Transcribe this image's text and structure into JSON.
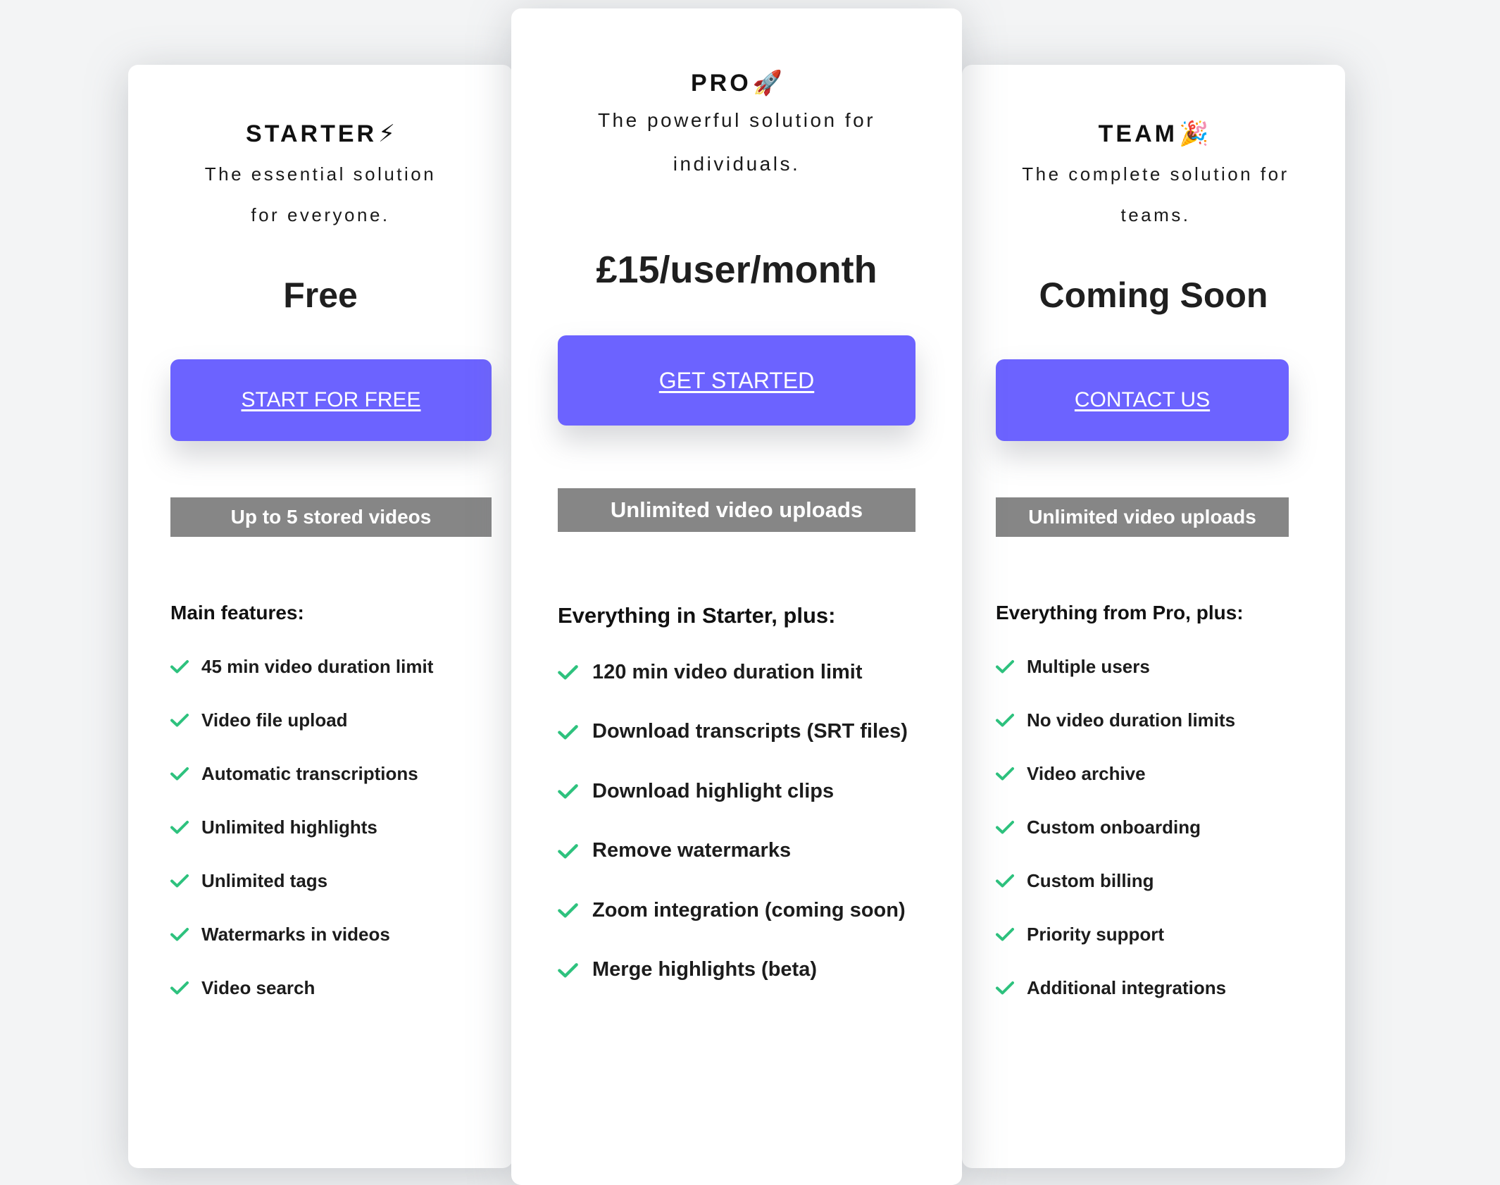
{
  "plans": {
    "starter": {
      "name": "STARTER",
      "emoji": "⚡",
      "description": "The essential solution for everyone.",
      "price": "Free",
      "cta_label": "START FOR FREE",
      "tag": "Up to 5 stored videos",
      "features_heading": "Main features:",
      "features": [
        "45 min video duration limit",
        "Video file upload",
        "Automatic transcriptions",
        "Unlimited highlights",
        "Unlimited tags",
        "Watermarks in videos",
        "Video search"
      ]
    },
    "pro": {
      "name": "PRO",
      "emoji": "🚀",
      "description": "The powerful solution for individuals.",
      "price": "£15/user/month",
      "cta_label": "GET STARTED",
      "tag": "Unlimited video uploads",
      "features_heading": "Everything in Starter, plus:",
      "features": [
        "120 min video duration limit",
        "Download transcripts (SRT files)",
        "Download highlight clips",
        "Remove watermarks",
        "Zoom integration (coming soon)",
        "Merge highlights (beta)"
      ]
    },
    "team": {
      "name": "TEAM",
      "emoji": "🎉",
      "description": "The complete solution for teams.",
      "price": "Coming Soon",
      "cta_label": "CONTACT US",
      "tag": "Unlimited video uploads",
      "features_heading": "Everything from Pro, plus:",
      "features": [
        "Multiple users",
        "No video duration limits",
        "Video archive",
        "Custom onboarding",
        "Custom billing",
        "Priority support",
        "Additional integrations"
      ]
    }
  },
  "icons": {
    "feature_check": "check-icon"
  },
  "colors": {
    "accent": "#6c63ff",
    "check": "#2ec27e",
    "tag_bg": "#868686",
    "page_bg": "#f3f4f5"
  }
}
